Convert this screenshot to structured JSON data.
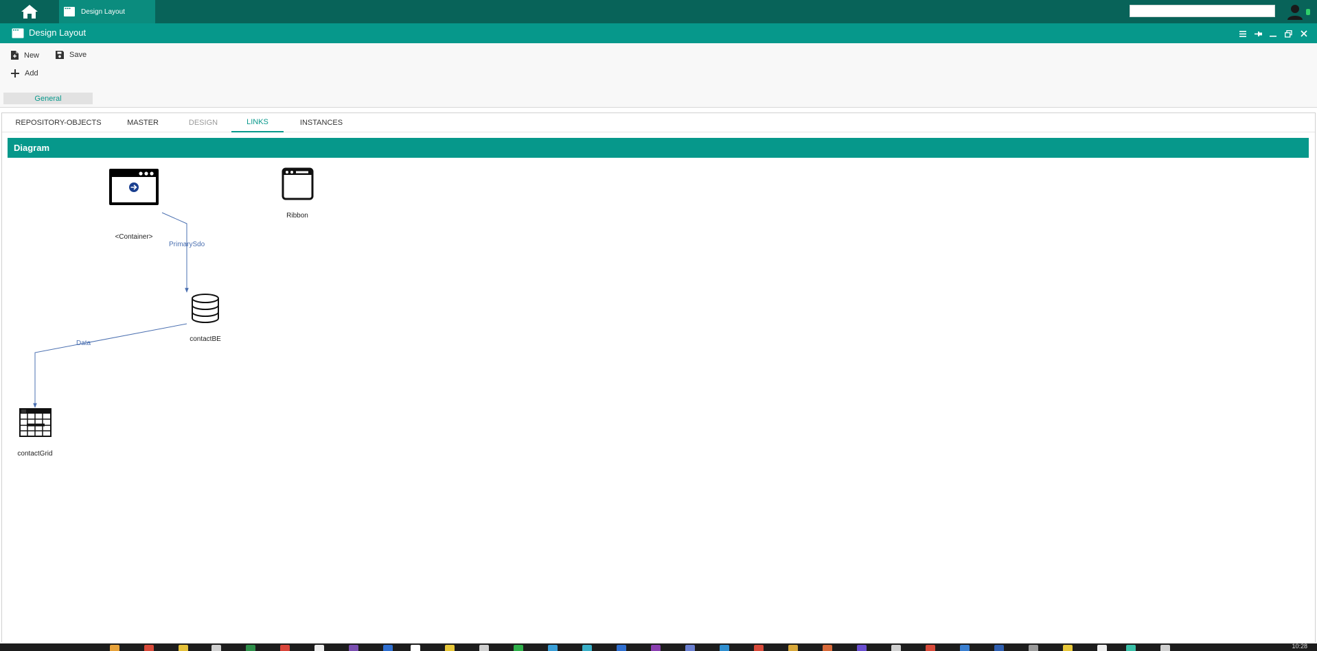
{
  "app": {
    "tab_label": "Design Layout",
    "search_placeholder": ""
  },
  "window": {
    "title": "Design Layout"
  },
  "toolbar": {
    "new_label": "New",
    "save_label": "Save",
    "add_label": "Add",
    "group_label": "General"
  },
  "tabs": [
    {
      "label": "REPOSITORY-OBJECTS",
      "state": "normal"
    },
    {
      "label": "MASTER",
      "state": "normal"
    },
    {
      "label": "DESIGN",
      "state": "disabled"
    },
    {
      "label": "LINKS",
      "state": "active"
    },
    {
      "label": "INSTANCES",
      "state": "normal"
    }
  ],
  "panel": {
    "title": "Diagram"
  },
  "diagram": {
    "nodes": [
      {
        "label": "<Container>",
        "icon": "window-run-icon"
      },
      {
        "label": "Ribbon",
        "icon": "window-icon"
      },
      {
        "label": "contactBE",
        "icon": "database-icon"
      },
      {
        "label": "contactGrid",
        "icon": "grid-icon"
      }
    ],
    "edges": [
      {
        "label": "PrimarySdo",
        "from": "<Container>",
        "to": "contactBE"
      },
      {
        "label": "Data",
        "from": "contactBE",
        "to": "contactGrid"
      }
    ],
    "edge_color": "#4a6fb0"
  },
  "taskbar": {
    "clock": "10:28"
  },
  "colors": {
    "topbar": "#086359",
    "accent": "#06988b",
    "active_tab": "#0b8c7e"
  }
}
